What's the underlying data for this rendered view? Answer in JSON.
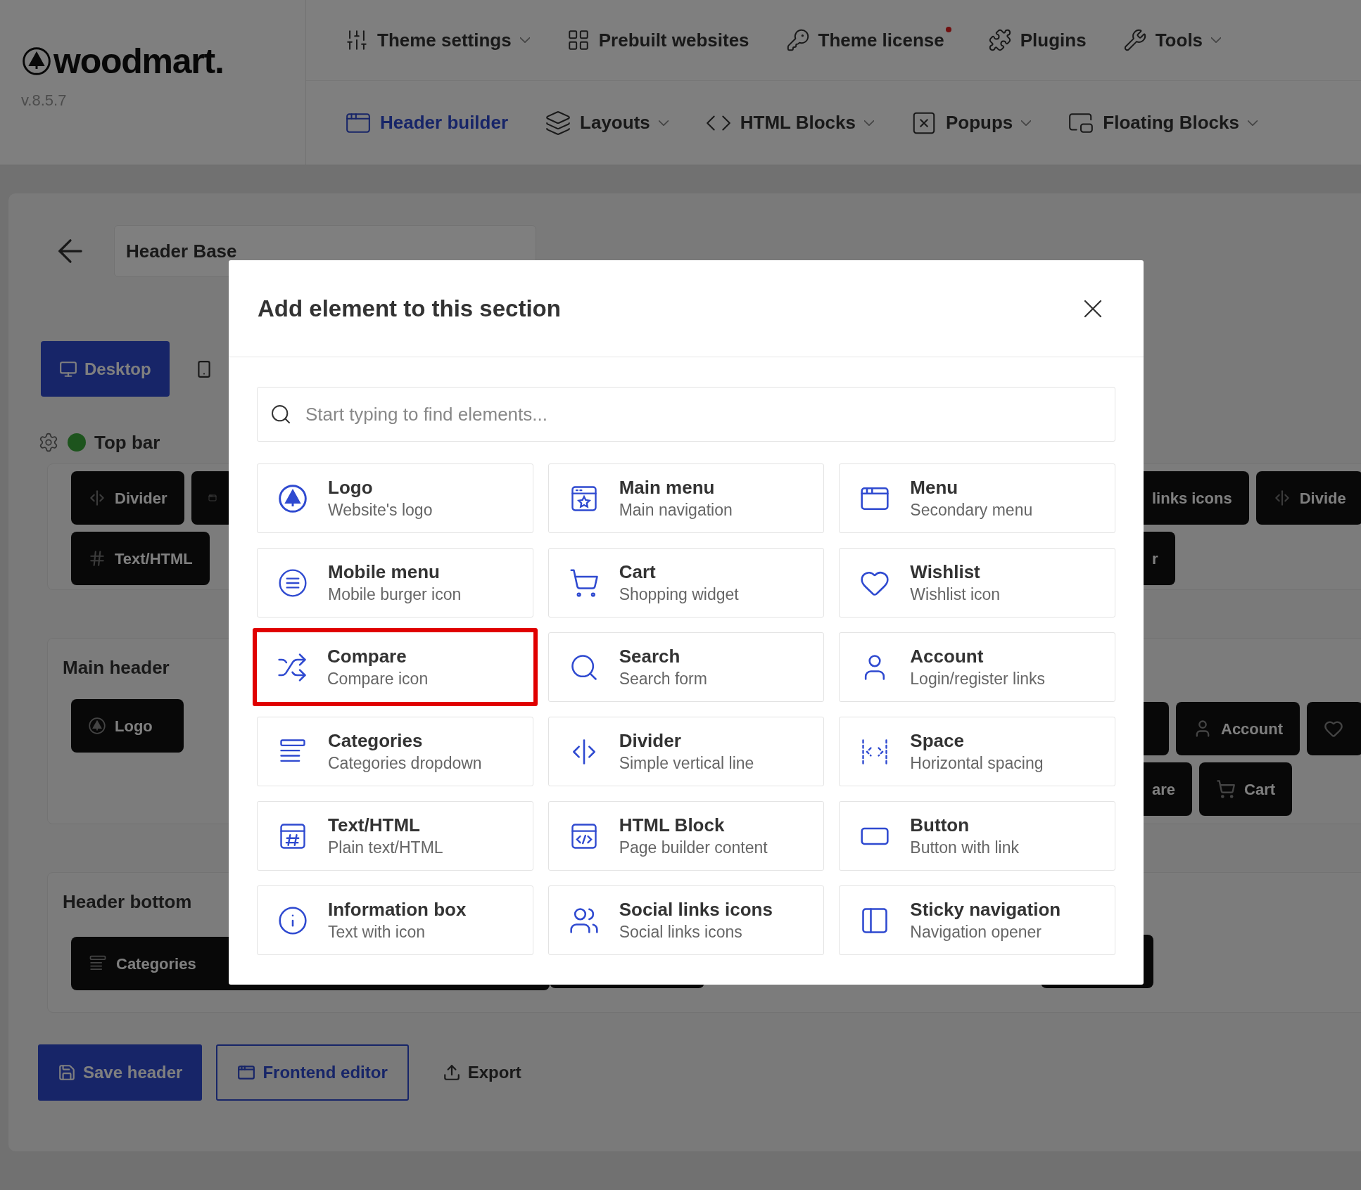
{
  "logo": {
    "text": "woodmart.",
    "version": "v.8.5.7"
  },
  "top_nav": [
    {
      "label": "Theme settings",
      "has_menu": true,
      "badge": false
    },
    {
      "label": "Prebuilt websites",
      "has_menu": false,
      "badge": false
    },
    {
      "label": "Theme license",
      "has_menu": false,
      "badge": true
    },
    {
      "label": "Plugins",
      "has_menu": false,
      "badge": false
    },
    {
      "label": "Tools",
      "has_menu": true,
      "badge": false
    }
  ],
  "sub_nav": [
    {
      "label": "Header builder",
      "has_menu": false,
      "selected": true
    },
    {
      "label": "Layouts",
      "has_menu": true,
      "selected": false
    },
    {
      "label": "HTML Blocks",
      "has_menu": true,
      "selected": false
    },
    {
      "label": "Popups",
      "has_menu": true,
      "selected": false
    },
    {
      "label": "Floating Blocks",
      "has_menu": true,
      "selected": false
    }
  ],
  "builder": {
    "header_name": "Header Base",
    "device_tabs": [
      {
        "label": "Desktop",
        "selected": true
      },
      {
        "selected": false
      }
    ],
    "top_bar": {
      "title": "Top bar",
      "enabled": true,
      "left": [
        "Divider",
        "Text/HTML"
      ],
      "right": [
        "links icons",
        "Divide",
        "r"
      ]
    },
    "main_header": {
      "title": "Main header",
      "left": [
        "Logo"
      ],
      "right": [
        "Account",
        "are",
        "Cart"
      ]
    },
    "header_bottom": {
      "title": "Header bottom",
      "left": [
        "Categories"
      ]
    },
    "actions": [
      "Save header",
      "Frontend editor",
      "Export"
    ]
  },
  "modal": {
    "title": "Add element to this section",
    "search": {
      "placeholder": "Start typing to find elements..."
    },
    "elements": [
      {
        "name": "Logo",
        "description": "Website's logo",
        "highlighted": false
      },
      {
        "name": "Main menu",
        "description": "Main navigation",
        "highlighted": false
      },
      {
        "name": "Menu",
        "description": "Secondary menu",
        "highlighted": false
      },
      {
        "name": "Mobile menu",
        "description": "Mobile burger icon",
        "highlighted": false
      },
      {
        "name": "Cart",
        "description": "Shopping widget",
        "highlighted": false
      },
      {
        "name": "Wishlist",
        "description": "Wishlist icon",
        "highlighted": false
      },
      {
        "name": "Compare",
        "description": "Compare icon",
        "highlighted": true
      },
      {
        "name": "Search",
        "description": "Search form",
        "highlighted": false
      },
      {
        "name": "Account",
        "description": "Login/register links",
        "highlighted": false
      },
      {
        "name": "Categories",
        "description": "Categories dropdown",
        "highlighted": false
      },
      {
        "name": "Divider",
        "description": "Simple vertical line",
        "highlighted": false
      },
      {
        "name": "Space",
        "description": "Horizontal spacing",
        "highlighted": false
      },
      {
        "name": "Text/HTML",
        "description": "Plain text/HTML",
        "highlighted": false
      },
      {
        "name": "HTML Block",
        "description": "Page builder content",
        "highlighted": false
      },
      {
        "name": "Button",
        "description": "Button with link",
        "highlighted": false
      },
      {
        "name": "Information box",
        "description": "Text with icon",
        "highlighted": false
      },
      {
        "name": "Social links icons",
        "description": "Social links icons",
        "highlighted": false
      },
      {
        "name": "Sticky navigation",
        "description": "Navigation opener",
        "highlighted": false
      }
    ]
  }
}
